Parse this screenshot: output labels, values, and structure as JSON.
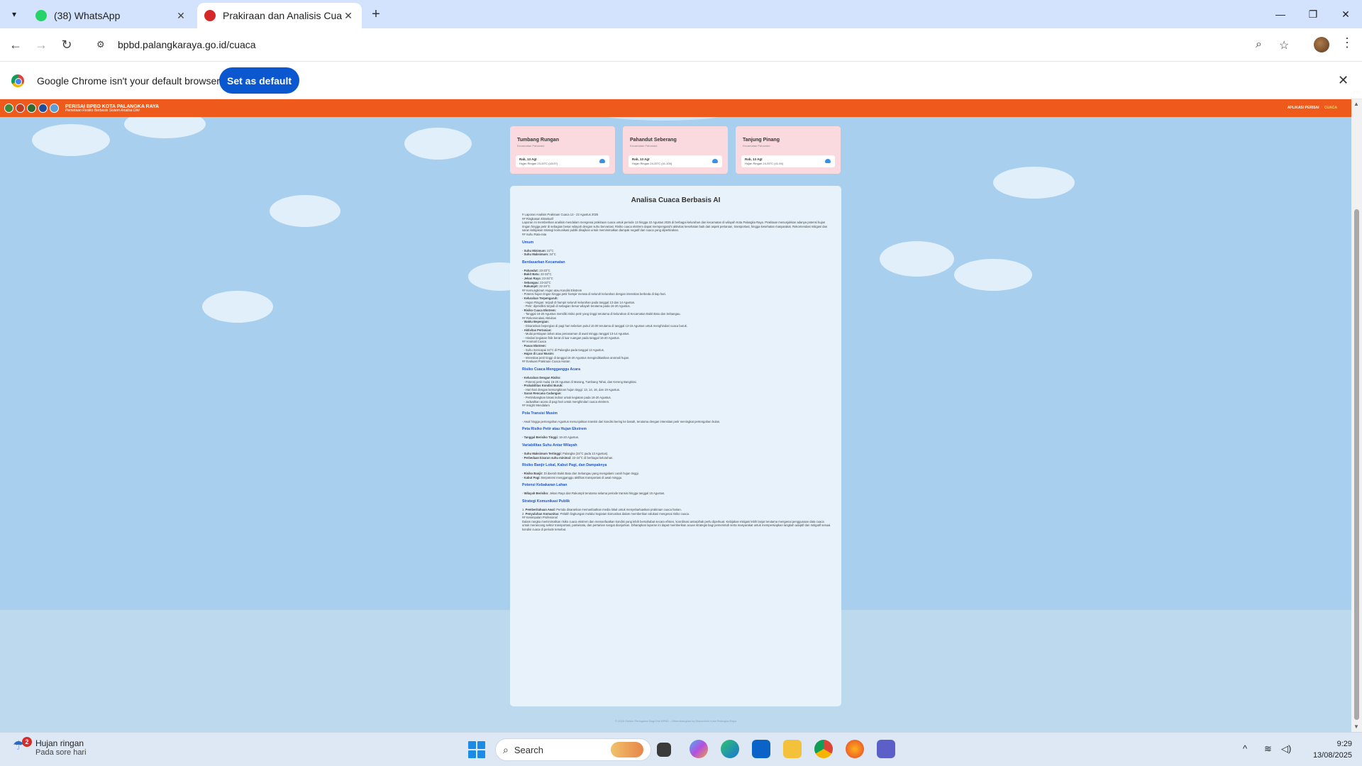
{
  "browser": {
    "tabs": [
      {
        "title": "(38) WhatsApp",
        "favicon": "whatsapp-icon",
        "active": false
      },
      {
        "title": "Prakiraan dan Analisis Cuaca Ko",
        "favicon": "bpbd-icon",
        "active": true
      }
    ],
    "url": "bpbd.palangkaraya.go.id/cuaca",
    "infobar": {
      "message": "Google Chrome isn't your default browser",
      "button": "Set as default"
    }
  },
  "site": {
    "brand_name": "PERISAI BPBD KOTA PALANGKA RAYA",
    "brand_tagline": "Pemetaan Resiko Berbasis Sistem Analisa Dini",
    "nav": [
      {
        "label": "APLIKASI PERISAI",
        "active": false
      },
      {
        "label": "CUACA",
        "active": true
      }
    ]
  },
  "forecast_cards": [
    {
      "name": "Tumbang Rungan",
      "district": "Kecamatan Pahandut",
      "date": "Rab, 13 Agt",
      "weather": "Hujan Ringan 23-33°C (43-97)"
    },
    {
      "name": "Pahandut Seberang",
      "district": "Kecamatan Pahandut",
      "date": "Rab, 13 Agt",
      "weather": "Hujan Ringan 24-33°C (41-100)"
    },
    {
      "name": "Tanjung Pinang",
      "district": "Kecamatan Pahandut",
      "date": "Rab, 13 Agt",
      "weather": "Hujan Ringan 24-33°C (41-94)"
    }
  ],
  "analysis": {
    "title": "Analisa Cuaca Berbasis AI",
    "blocks": [
      {
        "t": "p",
        "text": "# Laporan Analisis Prakiraan Cuaca 13 - 22 Agustus 2025"
      },
      {
        "t": "p",
        "text": "## Ringkasan Eksekutif"
      },
      {
        "t": "p",
        "text": "Laporan ini memberikan analisis mendalam mengenai prakiraan cuaca untuk periode 13 hingga 22 Agustus 2025 di berbagai kelurahan dan kecamatan di wilayah Kota Palangka Raya. Prakiraan menunjukkan adanya potensi hujan ringan hingga petir di sebagian besar wilayah dengan suhu bervariasi. Risiko cuaca ekstrem dapat mempengaruhi aktivitas kesehatan baik dari aspek pertanian, transportasi, hingga kesehatan masyarakat. Rekomendasi mitigasi dan saran kebijakan strategi komunikasi publik disajikan untuk meminimalkan dampak negatif dari cuaca yang diperkirakan."
      },
      {
        "t": "p",
        "text": "## Suhu Rata-rata"
      },
      {
        "t": "h",
        "text": "Umum"
      },
      {
        "t": "li",
        "b": "Suhu Minimum:",
        "text": " 22°C"
      },
      {
        "t": "li",
        "b": "Suhu Maksimum:",
        "text": " 34°C"
      },
      {
        "t": "h",
        "text": "Berdasarkan Kecamatan"
      },
      {
        "t": "li",
        "b": "Pahandut:",
        "text": " 23-33°C"
      },
      {
        "t": "li",
        "b": "Bukit Batu:",
        "text": " 22-33°C"
      },
      {
        "t": "li",
        "b": "Jekan Raya:",
        "text": " 23-34°C"
      },
      {
        "t": "li",
        "b": "Sebangau:",
        "text": " 23-33°C"
      },
      {
        "t": "li",
        "b": "Rakumpit:",
        "text": " 22-34°C"
      },
      {
        "t": "p",
        "text": "## Kemungkinan Hujan atau Kondisi Ekstrem"
      },
      {
        "t": "li",
        "b": "",
        "text": "Potensi hujan ringan hingga petir hampir merata di seluruh kelurahan dengan intensitas berbeda di tiap hari."
      },
      {
        "t": "li",
        "b": "Kelurahan Terpengaruh:",
        "text": ""
      },
      {
        "t": "sub",
        "b": "",
        "text": "Hujan Ringan: terjadi di hampir seluruh kelurahan pada tanggal 13 dan 14 Agustus."
      },
      {
        "t": "sub",
        "b": "",
        "text": "Petir: diprediksi terjadi di sebagian besar wilayah terutama pada 16-20 Agustus."
      },
      {
        "t": "li",
        "b": "Risiko Cuaca Ekstrem:",
        "text": ""
      },
      {
        "t": "sub",
        "b": "",
        "text": "Tanggal 16-20 Agustus memiliki risiko petir yang tinggi terutama di kelurahan di Kecamatan Bukit Batu dan Sebangau."
      },
      {
        "t": "p",
        "text": "## Rekomendasi Aktivitas"
      },
      {
        "t": "li",
        "b": "Waktu Bepergian:",
        "text": ""
      },
      {
        "t": "sub",
        "b": "",
        "text": "Disarankan bepergian di pagi hari sebelum pukul 10.00 terutama di tanggal 13-15 Agustus untuk menghindari cuaca buruk."
      },
      {
        "t": "li",
        "b": "Aktivitas Pertanian:",
        "text": ""
      },
      {
        "t": "sub",
        "b": "",
        "text": "Mulai persiapan lahan atau penanaman di awal minggu tanggal 13-14 Agustus."
      },
      {
        "t": "sub",
        "b": "",
        "text": "Hindari kegiatan fisik berat di luar ruangan pada tanggal 16-20 Agustus."
      },
      {
        "t": "p",
        "text": "## Anomali Cuaca"
      },
      {
        "t": "li",
        "b": "Panas Ekstrem:",
        "text": ""
      },
      {
        "t": "sub",
        "b": "",
        "text": "Suhu mencapai 34°C di Palangka pada tanggal 13 Agustus."
      },
      {
        "t": "li",
        "b": "Hujan di Luar Musim:",
        "text": ""
      },
      {
        "t": "sub",
        "b": "",
        "text": "Intensitas petir tinggi di tanggal 16-20 Agustus mengindikasikan anomali hujan."
      },
      {
        "t": "p",
        "text": "## Evaluasi Prakiraan Cuaca Harian"
      },
      {
        "t": "h",
        "text": "Risiko Cuaca Mengganggu Acara"
      },
      {
        "t": "li",
        "b": "Kelurahan Dengan Risiko:",
        "text": ""
      },
      {
        "t": "sub",
        "b": "",
        "text": "Potensi petir mulai 16-20 Agustus di Marang, Tumbang Tahai, dan Kereng Bangkirai."
      },
      {
        "t": "li",
        "b": "Probabilitas Kondisi Buruk:",
        "text": ""
      },
      {
        "t": "sub",
        "b": "",
        "text": "Hari-hari dengan kemungkinan hujan tinggi: 13, 14, 16, dan 19 Agustus."
      },
      {
        "t": "li",
        "b": "Saran Rencana Cadangan:",
        "text": ""
      },
      {
        "t": "sub",
        "b": "",
        "text": "Pertimbangkan lokasi indoor untuk kegiatan pada 16-20 Agustus."
      },
      {
        "t": "sub",
        "b": "",
        "text": "Jadwalkan acara di pagi hari untuk menghindari cuaca ekstrem."
      },
      {
        "t": "p",
        "text": "## Insight Mendalam"
      },
      {
        "t": "h",
        "text": "Pola Transisi Musim"
      },
      {
        "t": "li",
        "b": "",
        "text": "Awal hingga pertengahan Agustus menunjukkan transisi dari kondisi kering ke basah, terutama dengan intensitas petir meningkat pertengahan bulan."
      },
      {
        "t": "h",
        "text": "Peta Risiko Petir atau Hujan Ekstrem"
      },
      {
        "t": "li",
        "b": "Tanggal Berisiko Tinggi:",
        "text": " 16-20 Agustus."
      },
      {
        "t": "h",
        "text": "Variabilitas Suhu Antar Wilayah"
      },
      {
        "t": "li",
        "b": "Suhu Maksimum Tertinggi:",
        "text": " Palangka (34°C pada 13 Agustus)."
      },
      {
        "t": "li",
        "b": "Perbedaan kisaran suhu minimal:",
        "text": " 22-24°C di berbagai kelurahan."
      },
      {
        "t": "h",
        "text": "Risiko Banjir Lokal, Kabut Pagi, dan Dampaknya"
      },
      {
        "t": "li",
        "b": "Risiko Banjir:",
        "text": " Di daerah Bukit Batu dan Sebangau yang mengalami curah hujan tinggi."
      },
      {
        "t": "li",
        "b": "Kabut Pagi:",
        "text": " Berpotensi mengganggu aktifitas transportasi di awal minggu."
      },
      {
        "t": "h",
        "text": "Potensi Kebakaran Lahan"
      },
      {
        "t": "li",
        "b": "Wilayah Berisiko:",
        "text": " Jekan Raya dan Rakumpit terutama selama periode transisi hingga tanggal 15 Agustus."
      },
      {
        "t": "h",
        "text": "Strategi Komunikasi Publik"
      },
      {
        "t": "num",
        "n": "1.",
        "b": "Pemberitahuan Awal:",
        "text": " Pemda disarankan memanfaatkan media lokal untuk menyebarluaskan prakiraan cuaca harian."
      },
      {
        "t": "num",
        "n": "2.",
        "b": "Penyuluhan Komunitas:",
        "text": " Pelatih lingkungan melalui kegiatan komunitas dalam memberikan edukasi mengenai risiko cuaca."
      },
      {
        "t": "p",
        "text": "## Kesimpulan Profesional"
      },
      {
        "t": "p",
        "text": "Dalam rangka meminimalkan risiko cuaca ekstrem dan memanfaatkan kondisi yang lebih bersahabat secara efisien, koordinasi antarpihak perlu diperkuat. Kebijakan mitigasi lebih lanjut terutama mengenai penggunaan data cuaca untuk merancang sektor transportasi, pariwisata, dan pertanian sangat dianjurkan. Diharapkan laporan ini dapat memberikan acuan strategis bagi pemerintah serta masyarakat untuk mempersiapkan langkah adaptif dan mitigatif sesuai kondisi cuaca di periode tersebut."
      }
    ]
  },
  "footer": "© 2025 Sistem Peringatan Bagi Dini BPBD – Dikembangkan by Diskominfo Kota Palangka Raya",
  "taskbar": {
    "weather": {
      "badge": "2",
      "line1": "Hujan ringan",
      "line2": "Pada sore hari"
    },
    "search_placeholder": "Search",
    "time": "9:29",
    "date": "13/08/2025"
  },
  "colors": {
    "site_bar": "#ee5a1c",
    "card_bg": "#fadadf",
    "heading_blue": "#2255c8",
    "accent": "#0b57d0"
  }
}
